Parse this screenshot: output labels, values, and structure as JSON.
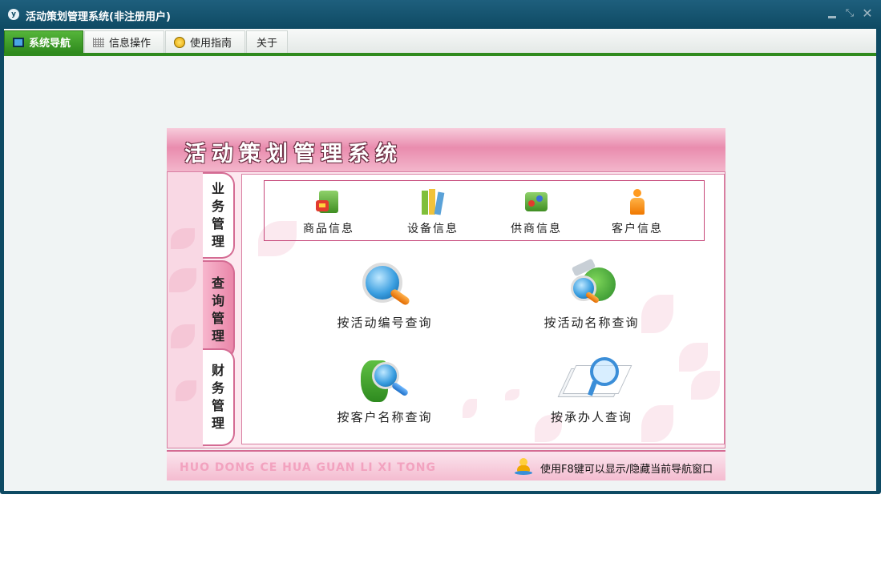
{
  "window": {
    "app_icon": "y",
    "title": "活动策划管理系统(非注册用户)",
    "controls": {
      "minimize": "minimize-icon",
      "restore": "restore-icon",
      "close": "✕"
    }
  },
  "menu": {
    "tabs": [
      {
        "label": "系统导航",
        "icon": "monitor-icon",
        "active": true
      },
      {
        "label": "信息操作",
        "icon": "grid-icon",
        "active": false
      },
      {
        "label": "使用指南",
        "icon": "guide-icon",
        "active": false
      },
      {
        "label": "关于",
        "icon": "",
        "active": false
      }
    ]
  },
  "panel": {
    "banner_title": "活动策划管理系统",
    "side_tabs": [
      {
        "label": "业务管理",
        "chars": [
          "业",
          "务",
          "管",
          "理"
        ],
        "active": false
      },
      {
        "label": "查询管理",
        "chars": [
          "查",
          "询",
          "管",
          "理"
        ],
        "active": true
      },
      {
        "label": "财务管理",
        "chars": [
          "财",
          "务",
          "管",
          "理"
        ],
        "active": false
      }
    ],
    "business_items": [
      {
        "label": "商品信息",
        "icon": "goods-icon"
      },
      {
        "label": "设备信息",
        "icon": "equipment-icon"
      },
      {
        "label": "供商信息",
        "icon": "supplier-icon"
      },
      {
        "label": "客户信息",
        "icon": "customer-icon"
      }
    ],
    "query_items": [
      {
        "label": "按活动编号查询",
        "icon": "magnifier-icon"
      },
      {
        "label": "按活动名称查询",
        "icon": "globe-search-icon"
      },
      {
        "label": "按客户名称查询",
        "icon": "map-search-icon"
      },
      {
        "label": "按承办人查询",
        "icon": "document-search-icon"
      }
    ],
    "footer_latin": "HUO DONG CE HUA GUAN LI XI TONG",
    "footer_hint": "使用F8键可以显示/隐藏当前导航窗口"
  },
  "colors": {
    "window_frame": "#0e4a63",
    "menu_accent": "#2f8a1d",
    "panel_pink": "#e98cae",
    "panel_border": "#d46b93"
  }
}
